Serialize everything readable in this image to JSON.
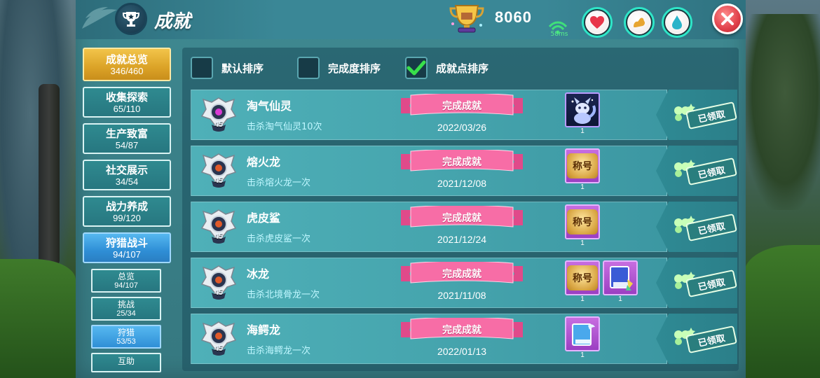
{
  "header": {
    "title": "成就",
    "score": "8060",
    "ping": "58ms",
    "stats": [
      {
        "icon": "heart-icon",
        "color": "#e8364a"
      },
      {
        "icon": "arm-strength-icon",
        "color": "#e7a531"
      },
      {
        "icon": "water-drop-icon",
        "color": "#2ab3c9"
      }
    ]
  },
  "sidebar": {
    "categories": [
      {
        "label": "成就总览",
        "count": "346/460",
        "style": "gold"
      },
      {
        "label": "收集探索",
        "count": "65/110",
        "style": "normal"
      },
      {
        "label": "生产致富",
        "count": "54/87",
        "style": "normal"
      },
      {
        "label": "社交展示",
        "count": "34/54",
        "style": "normal"
      },
      {
        "label": "战力养成",
        "count": "99/120",
        "style": "normal"
      },
      {
        "label": "狩猎战斗",
        "count": "94/107",
        "style": "selected"
      }
    ],
    "subcategories": [
      {
        "label": "总览",
        "count": "94/107"
      },
      {
        "label": "挑战",
        "count": "25/34"
      },
      {
        "label": "狩猎",
        "count": "53/53"
      },
      {
        "label": "互助",
        "count": ""
      }
    ]
  },
  "sort": {
    "options": [
      {
        "label": "默认排序",
        "checked": false
      },
      {
        "label": "完成度排序",
        "checked": false
      },
      {
        "label": "成就点排序",
        "checked": true
      }
    ]
  },
  "achievements": [
    {
      "name": "淘气仙灵",
      "desc": "击杀淘气仙灵10次",
      "level": "45",
      "status": "完成成就",
      "date": "2022/03/26",
      "rewards": [
        {
          "type": "pet-portrait",
          "count": "1"
        }
      ],
      "claim": "已领取"
    },
    {
      "name": "熔火龙",
      "desc": "击杀熔火龙一次",
      "level": "45",
      "status": "完成成就",
      "date": "2021/12/08",
      "rewards": [
        {
          "type": "title",
          "label": "称号",
          "count": "1"
        }
      ],
      "claim": "已领取"
    },
    {
      "name": "虎皮鲨",
      "desc": "击杀虎皮鲨一次",
      "level": "45",
      "status": "完成成就",
      "date": "2021/12/24",
      "rewards": [
        {
          "type": "title",
          "label": "称号",
          "count": "1"
        }
      ],
      "claim": "已领取"
    },
    {
      "name": "冰龙",
      "desc": "击杀北境骨龙一次",
      "level": "45",
      "status": "完成成就",
      "date": "2021/11/08",
      "rewards": [
        {
          "type": "title",
          "label": "称号",
          "count": "1"
        },
        {
          "type": "book",
          "count": "1"
        }
      ],
      "claim": "已领取"
    },
    {
      "name": "海鳄龙",
      "desc": "击杀海鳄龙一次",
      "level": "45",
      "status": "完成成就",
      "date": "2022/01/13",
      "rewards": [
        {
          "type": "book-blue",
          "count": "1"
        }
      ],
      "claim": "已领取"
    }
  ]
}
